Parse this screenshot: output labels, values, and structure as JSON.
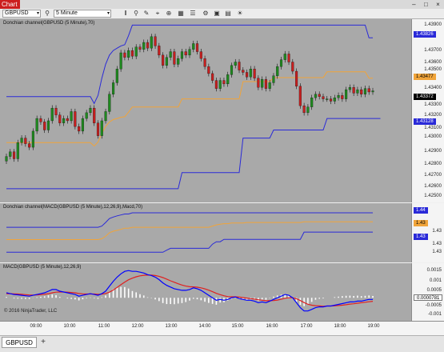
{
  "window": {
    "chart_tab": "Chart",
    "controls": [
      "–",
      "□",
      "×"
    ]
  },
  "toolbar": {
    "instrument": "GBPUSD",
    "interval": "5 Minute",
    "icons": [
      "bars-icon",
      "magnifier-icon",
      "pencil-icon",
      "crosshair-icon",
      "zoom-icon",
      "chart-style-icon",
      "properties-icon",
      "strategy-icon",
      "templates-icon",
      "data-box-icon",
      "settings-icon"
    ]
  },
  "panels": {
    "price": {
      "title": "Donchian channel(GBPUSD (5 Minute),70)",
      "y_labels": [
        "1.43900",
        "1.43826",
        "1.43700",
        "1.43600",
        "1.43500",
        "1.43477",
        "1.43400",
        "1.43372",
        "1.43300",
        "1.43200",
        "1.43128",
        "1.43100",
        "1.43000",
        "1.42900",
        "1.42800",
        "1.42700",
        "1.42600",
        "1.42500"
      ]
    },
    "donchian": {
      "title": "Donchian channel(MACD(GBPUSD (5 Minute),12,26,9),Macd,70)",
      "y_labels": [
        "1.44",
        "1.43",
        "1.43",
        "1.43",
        "1.43",
        "1.43"
      ]
    },
    "macd": {
      "title": "MACD(GBPUSD (5 Minute),12,26,9)",
      "y_labels": [
        "0.0015",
        "0.001",
        "0.0005",
        "0",
        "-0.0005",
        "-0.001"
      ]
    }
  },
  "badges": {
    "price_upper": "1.43826",
    "price_mid": "1.43477",
    "price_last": "1.43372",
    "price_lower": "1.43128",
    "donchian_upper": "1.44",
    "donchian_mid": "1.43",
    "donchian_lower": "1.43",
    "macd_value": "0.0000781"
  },
  "x_axis": {
    "labels": [
      "09:00",
      "10:00",
      "11:00",
      "12:00",
      "13:00",
      "14:00",
      "15:00",
      "16:00",
      "17:00",
      "18:00",
      "19:00"
    ]
  },
  "copyright": "© 2016 NinjaTrader, LLC",
  "tabs": {
    "active": "GBPUSD",
    "add": "+"
  },
  "colors": {
    "panel_bg": "#a9a9a9",
    "channel": "#2a2ad8",
    "mid": "#f0a43a",
    "bull": "#1e8a1e",
    "bear": "#c81e1e",
    "macd": "#0000ff",
    "signal": "#e02020",
    "histogram": "#ffffff"
  },
  "chart_data": {
    "type": "candlestick",
    "x_labels": [
      "09:00",
      "10:00",
      "11:00",
      "12:00",
      "13:00",
      "14:00",
      "15:00",
      "16:00",
      "17:00",
      "18:00",
      "19:00"
    ],
    "price": {
      "ylim": [
        1.4245,
        1.4395
      ],
      "close": [
        1.428,
        1.4284,
        1.4278,
        1.4292,
        1.4296,
        1.4291,
        1.4288,
        1.4302,
        1.4313,
        1.431,
        1.4303,
        1.4311,
        1.4322,
        1.4316,
        1.4309,
        1.4313,
        1.4311,
        1.4319,
        1.4306,
        1.4302,
        1.4313,
        1.4318,
        1.4322,
        1.4309,
        1.4298,
        1.4311,
        1.4319,
        1.4334,
        1.4344,
        1.4356,
        1.437,
        1.4366,
        1.4372,
        1.4367,
        1.4375,
        1.4373,
        1.4379,
        1.4374,
        1.4384,
        1.4376,
        1.4368,
        1.4359,
        1.4366,
        1.4371,
        1.436,
        1.4365,
        1.4371,
        1.4368,
        1.4373,
        1.4378,
        1.4371,
        1.4365,
        1.4358,
        1.4352,
        1.4346,
        1.4339,
        1.4346,
        1.4343,
        1.4351,
        1.4359,
        1.4362,
        1.4355,
        1.4353,
        1.4349,
        1.4356,
        1.4348,
        1.434,
        1.4347,
        1.4339,
        1.4344,
        1.435,
        1.4358,
        1.4364,
        1.4369,
        1.4362,
        1.4354,
        1.4341,
        1.4324,
        1.4318,
        1.4323,
        1.4331,
        1.4334,
        1.4332,
        1.433,
        1.433,
        1.4328,
        1.4331,
        1.4333,
        1.433,
        1.4338,
        1.434,
        1.4335,
        1.4338,
        1.4334,
        1.4339,
        1.4336,
        1.4337
      ],
      "upper_channel": [
        1.4332,
        1.4332,
        1.4332,
        1.4332,
        1.4332,
        1.4332,
        1.4332,
        1.4332,
        1.4332,
        1.4332,
        1.4332,
        1.4332,
        1.4332,
        1.4332,
        1.4332,
        1.4332,
        1.4332,
        1.4332,
        1.4332,
        1.4332,
        1.4332,
        1.4332,
        1.4332,
        1.4326,
        1.4333,
        1.4348,
        1.436,
        1.4368,
        1.4372,
        1.4374,
        1.4376,
        1.4377,
        1.4385,
        1.4394,
        1.4394,
        1.4394,
        1.4394,
        1.4394,
        1.4394,
        1.4394,
        1.4394,
        1.4394,
        1.4394,
        1.4394,
        1.4394,
        1.4394,
        1.4394,
        1.4394,
        1.4394,
        1.4394,
        1.4394,
        1.4394,
        1.4394,
        1.4394,
        1.4394,
        1.4394,
        1.4394,
        1.4394,
        1.4394,
        1.4394,
        1.4394,
        1.4394,
        1.4394,
        1.4394,
        1.4394,
        1.4394,
        1.4394,
        1.4394,
        1.4394,
        1.4394,
        1.4394,
        1.4394,
        1.4394,
        1.4394,
        1.4394,
        1.4394,
        1.4394,
        1.4394,
        1.4394,
        1.4394,
        1.4394,
        1.4394,
        1.4394,
        1.4394,
        1.4394,
        1.4394,
        1.4394,
        1.4394,
        1.4394,
        1.4394,
        1.4394,
        1.4394,
        1.4394,
        1.4394,
        1.4394,
        1.4383,
        1.4383
      ],
      "lower_channel": [
        1.4252,
        1.4252,
        1.4252,
        1.4252,
        1.4252,
        1.4252,
        1.4252,
        1.4252,
        1.4252,
        1.4252,
        1.4252,
        1.4252,
        1.4252,
        1.4252,
        1.4252,
        1.4252,
        1.4252,
        1.4252,
        1.4252,
        1.4252,
        1.4252,
        1.4252,
        1.4252,
        1.4252,
        1.4252,
        1.4252,
        1.4252,
        1.4252,
        1.4252,
        1.4252,
        1.4252,
        1.4252,
        1.4252,
        1.4252,
        1.4252,
        1.4252,
        1.4252,
        1.4252,
        1.4252,
        1.4252,
        1.4252,
        1.4252,
        1.4252,
        1.4252,
        1.4252,
        1.4252,
        1.4266,
        1.4266,
        1.4266,
        1.4266,
        1.4266,
        1.4266,
        1.4266,
        1.4266,
        1.4266,
        1.4266,
        1.4266,
        1.4266,
        1.4266,
        1.4266,
        1.4266,
        1.4266,
        1.4296,
        1.4296,
        1.4296,
        1.4296,
        1.4296,
        1.4296,
        1.4296,
        1.4296,
        1.4303,
        1.4303,
        1.4303,
        1.4303,
        1.4303,
        1.4303,
        1.4303,
        1.4303,
        1.4303,
        1.4303,
        1.4303,
        1.4303,
        1.4303,
        1.4303,
        1.4313,
        1.4313,
        1.4313,
        1.4313,
        1.4313,
        1.4313,
        1.4313,
        1.4313,
        1.4313,
        1.4313,
        1.4313,
        1.4313,
        1.4313,
        1.4313,
        1.4313
      ]
    },
    "macd": {
      "ylim": [
        -0.0012,
        0.0019
      ],
      "macd": [
        0.0003,
        0.00025,
        0.0002,
        0.00018,
        0.00015,
        0.00012,
        0.0001,
        0.00015,
        0.0002,
        0.00025,
        0.0003,
        0.0004,
        0.0005,
        0.0005,
        0.0004,
        0.00035,
        0.0003,
        0.00025,
        0.0002,
        0.0001,
        0.00015,
        0.0002,
        0.00025,
        0.0002,
        0.00015,
        0.00025,
        0.0004,
        0.0007,
        0.001,
        0.00125,
        0.00145,
        0.0016,
        0.00165,
        0.0016,
        0.0016,
        0.00155,
        0.0015,
        0.0014,
        0.00135,
        0.00125,
        0.0011,
        0.0009,
        0.00075,
        0.00065,
        0.00055,
        0.0005,
        0.00045,
        0.00045,
        0.0005,
        0.0006,
        0.00055,
        0.00045,
        0.0003,
        0.00015,
        0.0,
        -0.00015,
        -0.0001,
        -0.00015,
        -0.0001,
        0.0,
        5e-05,
        -5e-05,
        -0.0001,
        -0.00015,
        -0.00015,
        -0.0002,
        -0.0003,
        -0.00025,
        -0.0003,
        -0.0002,
        -0.0001,
        0.0,
        0.0001,
        0.0002,
        0.00015,
        0.0,
        -0.0003,
        -0.0006,
        -0.0008,
        -0.0008,
        -0.0007,
        -0.0006,
        -0.00055,
        -0.00055,
        -0.0005,
        -0.0005,
        -0.00045,
        -0.0004,
        -0.00035,
        -0.0003,
        -0.00025,
        -0.00025,
        -0.0002,
        -0.0002,
        -0.00015,
        -0.0001,
        -0.0001
      ],
      "signal": [
        0.00025,
        0.00025,
        0.00024,
        0.00023,
        0.00021,
        0.00019,
        0.00017,
        0.00016,
        0.00017,
        0.00019,
        0.00021,
        0.00025,
        0.0003,
        0.00034,
        0.00035,
        0.00035,
        0.00034,
        0.00032,
        0.0003,
        0.00026,
        0.00024,
        0.00023,
        0.00023,
        0.00023,
        0.00021,
        0.00022,
        0.00026,
        0.00034,
        0.00047,
        0.00063,
        0.00079,
        0.00095,
        0.00109,
        0.00119,
        0.00127,
        0.00133,
        0.00136,
        0.00137,
        0.00137,
        0.00135,
        0.0013,
        0.00122,
        0.00113,
        0.00103,
        0.00094,
        0.00085,
        0.00077,
        0.00071,
        0.00067,
        0.00066,
        0.00064,
        0.0006,
        0.00054,
        0.00046,
        0.00037,
        0.00027,
        0.00019,
        0.00012,
        7e-05,
        6e-05,
        6e-05,
        4e-05,
        1e-05,
        -2e-05,
        -5e-05,
        -8e-05,
        -0.00012,
        -0.00015,
        -0.00018,
        -0.00018,
        -0.00017,
        -0.00014,
        -9e-05,
        -3e-05,
        0.0,
        0.0,
        -6e-05,
        -0.00017,
        -0.00029,
        -0.00039,
        -0.00045,
        -0.00048,
        -0.00049,
        -0.00051,
        -0.0005,
        -0.0005,
        -0.00049,
        -0.00047,
        -0.00045,
        -0.00042,
        -0.00038,
        -0.00036,
        -0.00033,
        -0.0003,
        -0.00027,
        -0.00024,
        -0.00021
      ]
    },
    "donchian_of_macd": {
      "ylim": [
        1.429,
        1.446
      ],
      "upper": [
        1.4396,
        1.4396,
        1.4396,
        1.4396,
        1.4396,
        1.4396,
        1.4396,
        1.4396,
        1.4396,
        1.4396,
        1.4396,
        1.4396,
        1.4396,
        1.4396,
        1.4396,
        1.4396,
        1.4396,
        1.4396,
        1.4396,
        1.4396,
        1.4396,
        1.4396,
        1.4396,
        1.4396,
        1.4396,
        1.44,
        1.4412,
        1.4425,
        1.443,
        1.4434,
        1.4437,
        1.444,
        1.444,
        1.4444,
        1.4444,
        1.4444,
        1.4444,
        1.4444,
        1.4444,
        1.4444,
        1.4444,
        1.4444,
        1.4444,
        1.4444,
        1.4444,
        1.4444,
        1.4444,
        1.4444,
        1.4444,
        1.4444,
        1.4444,
        1.4444,
        1.4444,
        1.4444,
        1.4444,
        1.4444,
        1.4444,
        1.4444,
        1.4444,
        1.4444,
        1.4444,
        1.4444,
        1.4444,
        1.4444,
        1.4444,
        1.4444,
        1.4444,
        1.4444,
        1.4444,
        1.4444,
        1.4444,
        1.4444,
        1.4444,
        1.4444,
        1.4444,
        1.4444,
        1.4444,
        1.4444,
        1.4444,
        1.4444,
        1.4444,
        1.4444,
        1.4444,
        1.4444,
        1.4444,
        1.4444,
        1.4444,
        1.4444,
        1.4444,
        1.4444,
        1.4444,
        1.4444,
        1.4444,
        1.4444,
        1.4444,
        1.4444,
        1.4444
      ],
      "mid": [
        1.4355,
        1.4355,
        1.4355,
        1.4355,
        1.4355,
        1.4355,
        1.4355,
        1.4355,
        1.4355,
        1.4355,
        1.4355,
        1.4355,
        1.4355,
        1.4355,
        1.4355,
        1.4355,
        1.4355,
        1.4355,
        1.4355,
        1.4355,
        1.4355,
        1.4355,
        1.4355,
        1.4355,
        1.4355,
        1.4358,
        1.4366,
        1.4378,
        1.4383,
        1.4386,
        1.4389,
        1.4393,
        1.4393,
        1.4396,
        1.4396,
        1.4396,
        1.4396,
        1.4396,
        1.4396,
        1.4396,
        1.4396,
        1.4396,
        1.4396,
        1.4396,
        1.4396,
        1.4396,
        1.4396,
        1.4396,
        1.4396,
        1.4396,
        1.4396,
        1.4396,
        1.4396,
        1.4396,
        1.44,
        1.4404,
        1.4406,
        1.4408,
        1.4408,
        1.441,
        1.441,
        1.441,
        1.441,
        1.4412,
        1.4412,
        1.4412,
        1.4412,
        1.4412,
        1.4412,
        1.4412,
        1.4412,
        1.4412,
        1.4412,
        1.4412,
        1.4412,
        1.4412,
        1.4412,
        1.4412,
        1.4414,
        1.4414,
        1.4414,
        1.4414,
        1.4414,
        1.4414,
        1.4414,
        1.4414,
        1.4414,
        1.4414,
        1.4414,
        1.4414,
        1.4414,
        1.4414,
        1.4414,
        1.4414,
        1.4414,
        1.4414,
        1.4414
      ],
      "lower": [
        1.4313,
        1.4313,
        1.4313,
        1.4313,
        1.4313,
        1.4313,
        1.4313,
        1.4313,
        1.4313,
        1.4313,
        1.4313,
        1.4313,
        1.4313,
        1.4313,
        1.4313,
        1.4313,
        1.4313,
        1.4313,
        1.4313,
        1.4313,
        1.4313,
        1.4313,
        1.4313,
        1.4313,
        1.4313,
        1.4313,
        1.4313,
        1.4313,
        1.4313,
        1.4313,
        1.4313,
        1.4313,
        1.4313,
        1.4313,
        1.4313,
        1.4313,
        1.4313,
        1.4313,
        1.4313,
        1.4313,
        1.4313,
        1.4313,
        1.432,
        1.4326,
        1.4326,
        1.4326,
        1.4326,
        1.4326,
        1.4326,
        1.4326,
        1.4326,
        1.4326,
        1.4326,
        1.4326,
        1.434,
        1.4348,
        1.4348,
        1.4356,
        1.4356,
        1.4356,
        1.4356,
        1.4356,
        1.4356,
        1.4356,
        1.4356,
        1.4356,
        1.4356,
        1.4356,
        1.4356,
        1.4356,
        1.4356,
        1.4356,
        1.4356,
        1.4356,
        1.4356,
        1.4356,
        1.4356,
        1.4356,
        1.438,
        1.438,
        1.438,
        1.438,
        1.438,
        1.438,
        1.438,
        1.438,
        1.438,
        1.438,
        1.438,
        1.438,
        1.438,
        1.438,
        1.438,
        1.438,
        1.438,
        1.438,
        1.438
      ]
    }
  }
}
